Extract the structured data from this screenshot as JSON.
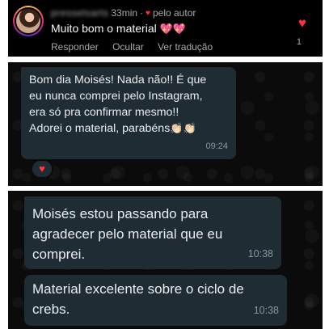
{
  "instagram_comment": {
    "username": "pressetsarts",
    "time_ago": "33min",
    "liked_by_author": "pelo autor",
    "text": "Muito bom o material",
    "emojis": "💖💖",
    "actions": [
      "Responder",
      "Ocultar",
      "Ver tradução"
    ],
    "like_count": "1",
    "colors": {
      "heart": "#ff3040",
      "background": "#000000"
    }
  },
  "whatsapp_1": {
    "message": "Bom dia Moisés! Nada não!! É que\neu nunca comprei pelo Instagram,\nera só pra confirmar mesmo!!\nAdorei o material, parabéns",
    "emoji": "👏🏻👏🏻",
    "time": "09:24",
    "reaction": "❤️"
  },
  "whatsapp_2": {
    "messages": [
      {
        "text": "Moisés  estou passando para agradecer pelo material  que eu comprei.",
        "time": "10:38"
      },
      {
        "text": "Material excelente  sobre o ciclo de crebs.",
        "time": "10:38"
      }
    ],
    "colors": {
      "bubble": "#1f2c34",
      "text": "#e9edef",
      "time": "#8696a0"
    }
  }
}
